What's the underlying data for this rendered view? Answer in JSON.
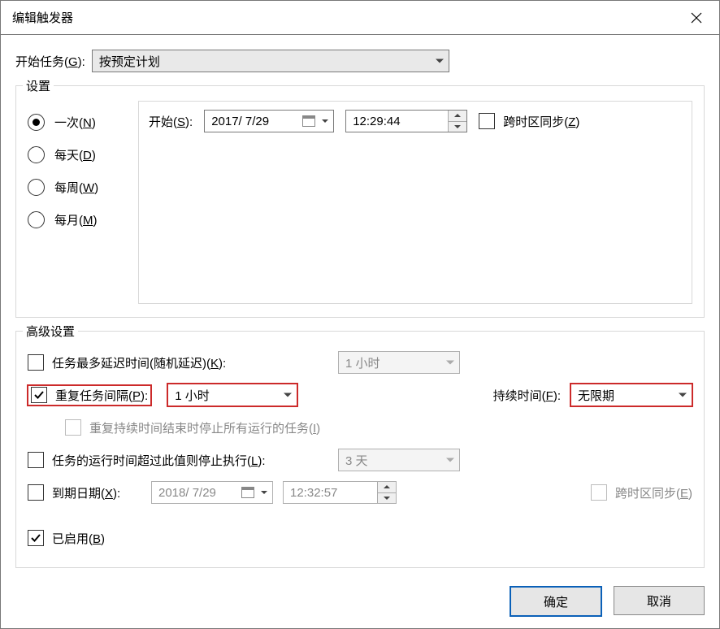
{
  "titlebar": {
    "title": "编辑触发器"
  },
  "start_task": {
    "label_prefix": "开始任务(",
    "label_acc": "G",
    "label_suffix": "):",
    "value": "按预定计划"
  },
  "settings": {
    "legend": "设置",
    "radios": {
      "once": {
        "pre": "一次(",
        "acc": "N",
        "suf": ")",
        "selected": true
      },
      "daily": {
        "pre": "每天(",
        "acc": "D",
        "suf": ")",
        "selected": false
      },
      "weekly": {
        "pre": "每周(",
        "acc": "W",
        "suf": ")",
        "selected": false
      },
      "monthly": {
        "pre": "每月(",
        "acc": "M",
        "suf": ")",
        "selected": false
      }
    },
    "start_label_pre": "开始(",
    "start_label_acc": "S",
    "start_label_suf": "):",
    "start_date": "2017/ 7/29",
    "start_time": "12:29:44",
    "sync_tz_pre": "跨时区同步(",
    "sync_tz_acc": "Z",
    "sync_tz_suf": ")",
    "sync_tz_checked": false
  },
  "advanced": {
    "legend": "高级设置",
    "delay": {
      "label_pre": "任务最多延迟时间(随机延迟)(",
      "label_acc": "K",
      "label_suf": "):",
      "checked": false,
      "value": "1 小时"
    },
    "repeat": {
      "label_pre": "重复任务间隔(",
      "label_acc": "P",
      "label_suf": "):",
      "checked": true,
      "value": "1 小时",
      "duration_label_pre": "持续时间(",
      "duration_label_acc": "F",
      "duration_label_suf": "):",
      "duration_value": "无限期",
      "stop_all_pre": "重复持续时间结束时停止所有运行的任务(",
      "stop_all_acc": "I",
      "stop_all_suf": ")"
    },
    "stop_longer": {
      "label_pre": "任务的运行时间超过此值则停止执行(",
      "label_acc": "L",
      "label_suf": "):",
      "checked": false,
      "value": "3 天"
    },
    "expire": {
      "label_pre": "到期日期(",
      "label_acc": "X",
      "label_suf": "):",
      "checked": false,
      "date": "2018/ 7/29",
      "time": "12:32:57",
      "sync_tz_pre": "跨时区同步(",
      "sync_tz_acc": "E",
      "sync_tz_suf": ")"
    },
    "enabled": {
      "label_pre": "已启用(",
      "label_acc": "B",
      "label_suf": ")",
      "checked": true
    }
  },
  "buttons": {
    "ok": "确定",
    "cancel": "取消"
  }
}
